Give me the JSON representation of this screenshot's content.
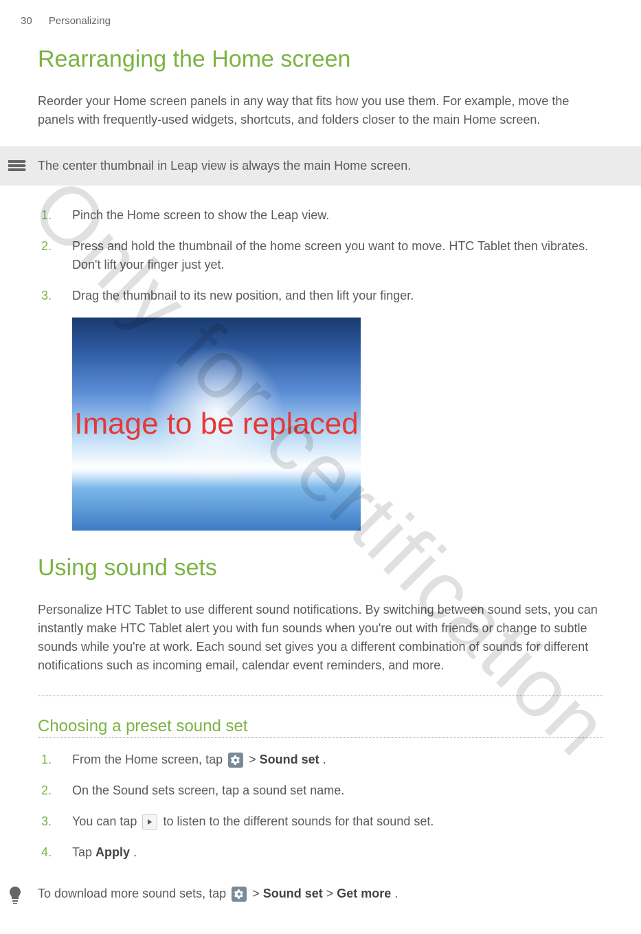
{
  "header": {
    "page_number": "30",
    "section": "Personalizing"
  },
  "section1": {
    "title": "Rearranging the Home screen",
    "intro": "Reorder your Home screen panels in any way that fits how you use them. For example, move the panels with frequently-used widgets, shortcuts, and folders closer to the main Home screen.",
    "note": "The center thumbnail in Leap view is always the main Home screen.",
    "steps": [
      "Pinch the Home screen to show the Leap view.",
      "Press and hold the thumbnail of the home screen you want to move. HTC Tablet then vibrates. Don't lift your finger just yet.",
      "Drag the thumbnail to its new position, and then lift your finger."
    ],
    "placeholder_text": "Image to be replaced"
  },
  "section2": {
    "title": "Using sound sets",
    "intro": "Personalize HTC Tablet to use different sound notifications. By switching between sound sets, you can instantly make HTC Tablet alert you with fun sounds when you're out with friends or change to subtle sounds while you're at work. Each sound set gives you a different combination of sounds for different notifications such as incoming email, calendar event reminders, and more.",
    "subsection_title": "Choosing a preset sound set",
    "steps": {
      "step1_pre": "From the Home screen, tap ",
      "step1_post1": " > ",
      "step1_bold": "Sound set",
      "step1_post2": ".",
      "step2": "On the Sound sets screen, tap a sound set name.",
      "step3_pre": "You can tap ",
      "step3_post": " to listen to the different sounds for that sound set.",
      "step4_pre": "Tap ",
      "step4_bold": "Apply",
      "step4_post": "."
    },
    "tip_pre": "To download more sound sets, tap ",
    "tip_mid1": " > ",
    "tip_bold1": "Sound set",
    "tip_mid2": " > ",
    "tip_bold2": "Get more",
    "tip_post": "."
  },
  "watermark": "Only for certification"
}
